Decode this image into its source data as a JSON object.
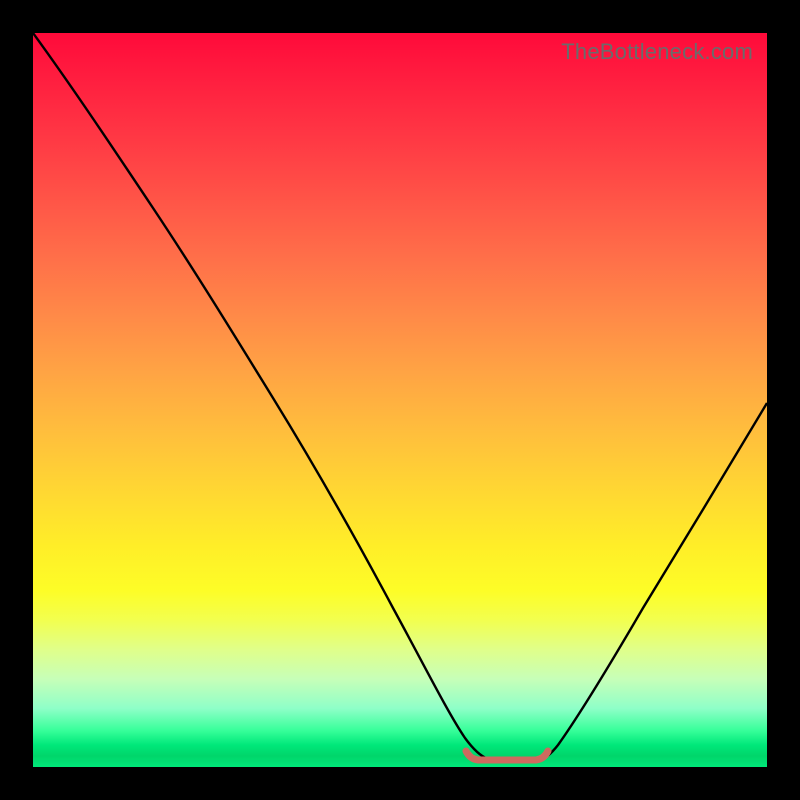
{
  "watermark": "TheBottleneck.com",
  "chart_data": {
    "type": "line",
    "title": "",
    "xlabel": "",
    "ylabel": "",
    "xlim": [
      0,
      100
    ],
    "ylim": [
      0,
      100
    ],
    "series": [
      {
        "name": "bottleneck-curve",
        "x": [
          0,
          5,
          10,
          15,
          20,
          25,
          30,
          35,
          40,
          45,
          50,
          55,
          58,
          60,
          62,
          65,
          68,
          70,
          75,
          80,
          85,
          90,
          95,
          100
        ],
        "values": [
          100,
          93,
          86,
          79,
          72,
          64,
          56,
          48,
          39,
          30,
          21,
          12,
          6,
          2,
          0,
          0,
          0,
          2,
          8,
          16,
          25,
          34,
          43,
          52
        ]
      },
      {
        "name": "sweet-spot-marker",
        "x": [
          60,
          62,
          64,
          66,
          68,
          70
        ],
        "values": [
          1.2,
          0.6,
          0.5,
          0.5,
          0.6,
          1.2
        ]
      }
    ],
    "colors": {
      "curve": "#000000",
      "marker": "#cd6a5f"
    }
  }
}
